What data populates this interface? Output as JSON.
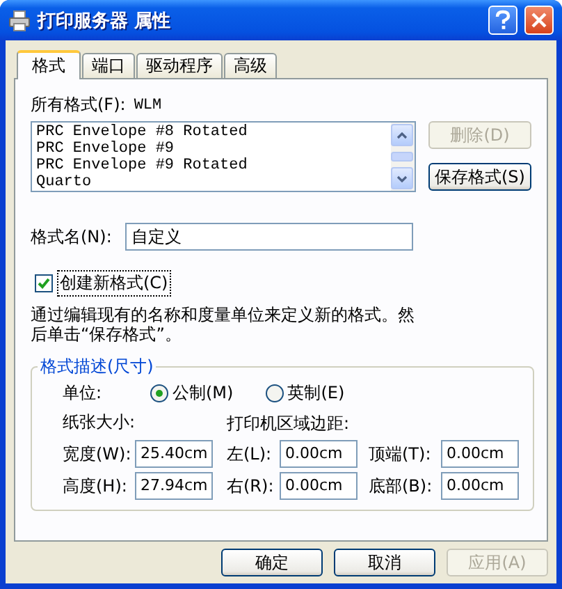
{
  "window": {
    "title": "打印服务器 属性"
  },
  "tabs": [
    {
      "label": "格式",
      "selected": true
    },
    {
      "label": "端口",
      "selected": false
    },
    {
      "label": "驱动程序",
      "selected": false
    },
    {
      "label": "高级",
      "selected": false
    }
  ],
  "all_formats": {
    "label": "所有格式(F):",
    "server": "WLM",
    "items": [
      "PRC Envelope #8 Rotated",
      "PRC Envelope #9",
      "PRC Envelope #9 Rotated",
      "Quarto"
    ]
  },
  "format_buttons": [
    {
      "label": "删除(D)",
      "disabled": true
    },
    {
      "label": "保存格式(S)",
      "disabled": false
    }
  ],
  "format_name": {
    "label": "格式名(N):",
    "value": "自定义"
  },
  "create_new": {
    "label": "创建新格式(C)",
    "checked": true
  },
  "description": "通过编辑现有的名称和度量单位来定义新的格式。然后单击“保存格式”。",
  "group": {
    "title": "格式描述(尺寸)",
    "units_label": "单位:",
    "units": [
      {
        "label": "公制(M)",
        "selected": true
      },
      {
        "label": "英制(E)",
        "selected": false
      }
    ],
    "paper_label": "纸张大小:",
    "margin_label": "打印机区域边距:",
    "rows": [
      [
        {
          "label": "宽度(W):",
          "value": "25.40cm"
        },
        {
          "label": "左(L):",
          "value": "0.00cm"
        },
        {
          "label": "顶端(T):",
          "value": "0.00cm"
        }
      ],
      [
        {
          "label": "高度(H):",
          "value": "27.94cm"
        },
        {
          "label": "右(R):",
          "value": "0.00cm"
        },
        {
          "label": "底部(B):",
          "value": "0.00cm"
        }
      ]
    ]
  },
  "buttons": [
    {
      "label": "确定",
      "disabled": false
    },
    {
      "label": "取消",
      "disabled": false
    },
    {
      "label": "应用(A)",
      "disabled": true
    }
  ]
}
